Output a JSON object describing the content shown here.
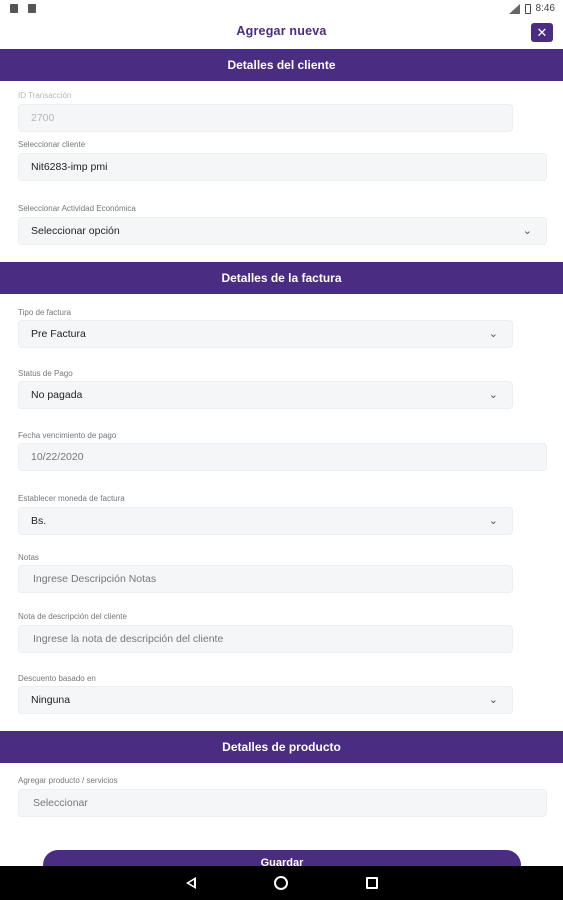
{
  "status_bar": {
    "time": "8:46",
    "icons": [
      "notification-icon",
      "notification-icon",
      "signal-icon",
      "battery-icon"
    ]
  },
  "header": {
    "title": "Agregar nueva",
    "close_label": "✕"
  },
  "sections": {
    "client": "Detalles del cliente",
    "invoice": "Detalles de la factura",
    "product": "Detalles de producto"
  },
  "client": {
    "transaction_label": "ID Transacción",
    "transaction_value": "2700",
    "client_label": "Seleccionar cliente",
    "client_value": "Nit6283-imp pmi",
    "activity_label": "Seleccionar Actividad Económica",
    "activity_value": "Seleccionar opción"
  },
  "invoice": {
    "type_label": "Tipo de factura",
    "type_value": "Pre Factura",
    "status_label": "Status de Pago",
    "status_value": "No pagada",
    "due_label": "Fecha vencimiento de pago",
    "due_value": "10/22/2020",
    "currency_label": "Establecer moneda de factura",
    "currency_value": "Bs.",
    "notes_label": "Notas",
    "notes_placeholder": "Ingrese Descripción Notas",
    "client_note_label": "Nota de descripción del cliente",
    "client_note_placeholder": "Ingrese la nota de descripción del cliente",
    "discount_label": "Descuento basado en",
    "discount_value": "Ninguna"
  },
  "product": {
    "add_label": "Agregar producto / servicios",
    "add_placeholder": "Seleccionar"
  },
  "footer": {
    "save_label": "Guardar"
  },
  "colors": {
    "primary": "#4a2c82",
    "field_bg": "#f5f6f8"
  }
}
